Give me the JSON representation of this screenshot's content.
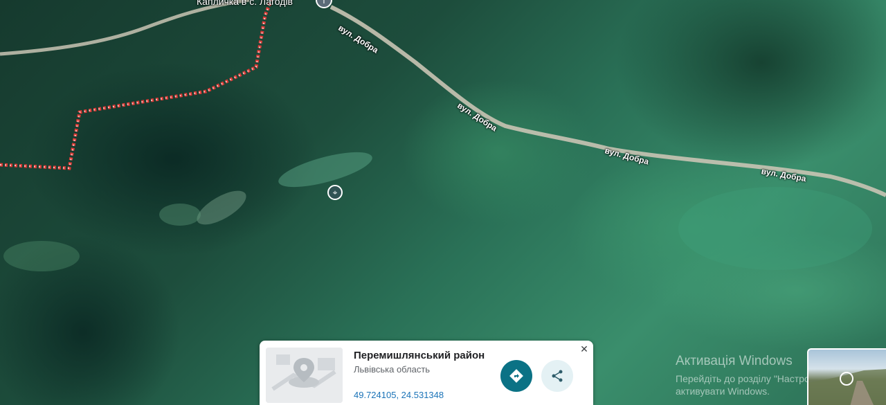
{
  "map": {
    "poi_label": "Капличка в с. Лагодів",
    "poi_icon": "info-icon",
    "road_labels": [
      "вул. Добра",
      "вул. Добра",
      "вул. Добра",
      "вул. Добра"
    ],
    "marker_icon": "location-pin-icon"
  },
  "card": {
    "title": "Перемишлянський район",
    "subtitle": "Львівська область",
    "coords": "49.724105, 24.531348",
    "close_icon": "close-icon",
    "directions_icon": "directions-icon",
    "share_icon": "share-icon"
  },
  "watermark": {
    "title": "Активація Windows",
    "line1": "Перейдіть до розділу \"Настройки\", щоб",
    "line2": "активувати Windows."
  },
  "colors": {
    "accent": "#0b7285",
    "coords": "#1a73b8",
    "boundary": "#e53935"
  }
}
